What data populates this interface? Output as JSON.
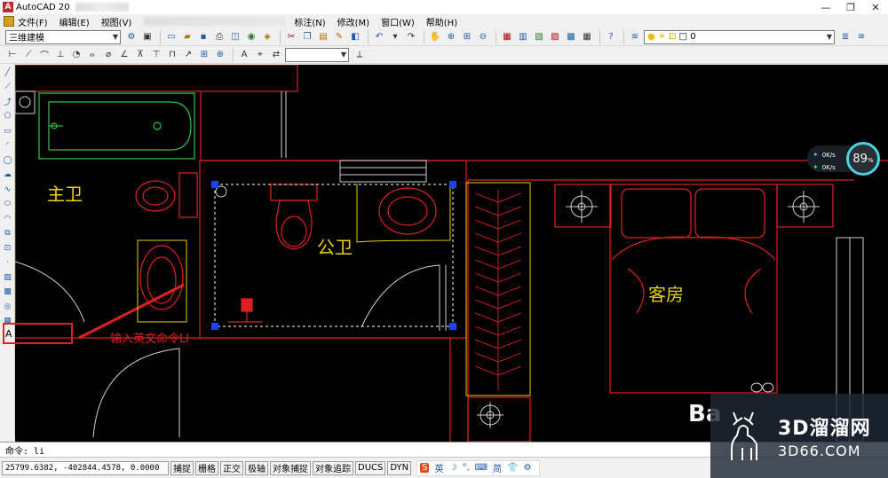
{
  "window": {
    "title": "AutoCAD 20",
    "app_icon": "A",
    "controls": {
      "minimize": "—",
      "restore": "❐",
      "close": "✕"
    }
  },
  "menu": {
    "items": [
      "文件(F)",
      "编辑(E)",
      "视图(V)",
      "标注(N)",
      "修改(M)",
      "窗口(W)",
      "帮助(H)"
    ]
  },
  "toolbar1": {
    "workspace_combo": "三维建模",
    "layer_combo": "0"
  },
  "toolbar2": {
    "style_combo": ""
  },
  "drawing": {
    "rooms": {
      "master_bath": "主卫",
      "public_bath": "公卫",
      "guest_room": "客房"
    },
    "annotation": {
      "box_letter": "A",
      "text": "输入英文命令LI"
    },
    "colors": {
      "background": "#000000",
      "walls": "#e02020",
      "fixtures": "#e02020",
      "tub_green": "#30c040",
      "label_yellow": "#e8d200",
      "white_lines": "#d0d0d0",
      "grip_blue": "#1e40ff"
    }
  },
  "speed_widget": {
    "upload": "0K/s",
    "download": "0K/s",
    "percent": "89",
    "percent_unit": "%"
  },
  "command_line": {
    "text": "命令: li"
  },
  "status": {
    "coords": "25799.6382, -402844.4578, 0.0000",
    "modes": [
      "捕捉",
      "栅格",
      "正交",
      "极轴",
      "对象捕捉",
      "对象追踪",
      "DUCS",
      "DYN"
    ],
    "ime": {
      "logo": "S",
      "items": [
        "英",
        "☽",
        "°,",
        "⌨",
        "简",
        "👕",
        "⚙"
      ]
    }
  },
  "watermark": {
    "baidu": "Ba",
    "title": "3D溜溜网",
    "url": "3D66.COM"
  }
}
